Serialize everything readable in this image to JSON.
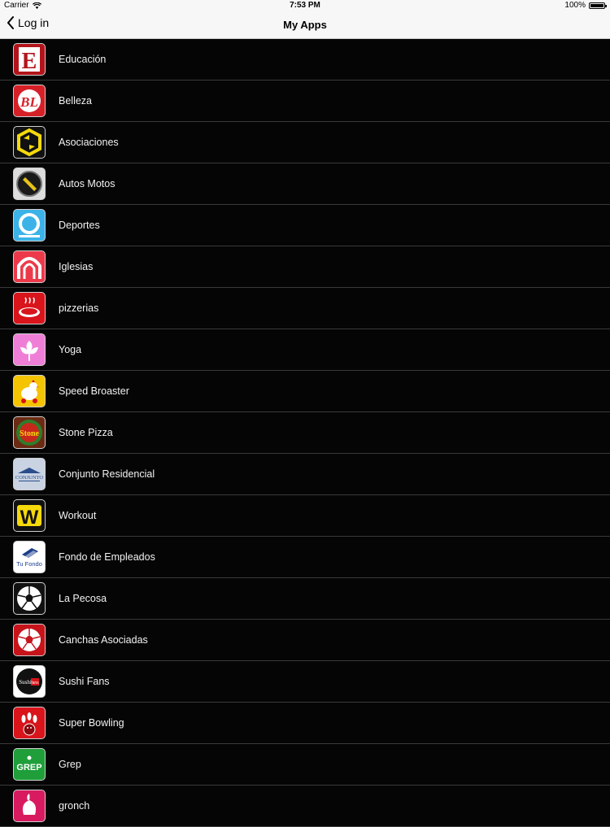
{
  "status": {
    "carrier": "Carrier",
    "time": "7:53 PM",
    "battery": "100%",
    "battery_level": 1.0
  },
  "nav": {
    "back_label": "Log in",
    "title": "My Apps"
  },
  "apps": [
    {
      "name": "Educación",
      "icon": "letter-e-icon"
    },
    {
      "name": "Belleza",
      "icon": "bl-monogram-icon"
    },
    {
      "name": "Asociaciones",
      "icon": "hexagon-arrows-icon"
    },
    {
      "name": "Autos Motos",
      "icon": "round-badge-icon"
    },
    {
      "name": "Deportes",
      "icon": "ring-icon"
    },
    {
      "name": "Iglesias",
      "icon": "arch-icon"
    },
    {
      "name": "pizzerias",
      "icon": "pizza-icon"
    },
    {
      "name": "Yoga",
      "icon": "lotus-icon"
    },
    {
      "name": "Speed Broaster",
      "icon": "chicken-mascot-icon"
    },
    {
      "name": "Stone Pizza",
      "icon": "stone-pizza-logo-icon"
    },
    {
      "name": "Conjunto Residencial",
      "icon": "building-logo-icon"
    },
    {
      "name": "Workout",
      "icon": "letter-w-icon"
    },
    {
      "name": "Fondo de Empleados",
      "icon": "tu-fondo-logo-icon"
    },
    {
      "name": "La Pecosa",
      "icon": "soccer-ball-icon"
    },
    {
      "name": "Canchas Asociadas",
      "icon": "red-soccer-ball-icon"
    },
    {
      "name": "Sushi Fans",
      "icon": "sushi-fans-logo-icon"
    },
    {
      "name": "Super Bowling",
      "icon": "bowling-icon"
    },
    {
      "name": "Grep",
      "icon": "grep-logo-icon"
    },
    {
      "name": "gronch",
      "icon": "gronch-logo-icon"
    }
  ],
  "icon_texts": {
    "educacion": "E",
    "belleza": "BL",
    "workout": "W",
    "tufondo": "Tu Fondo",
    "conjunto": "CONJUNTO",
    "sushi": "Sushi",
    "sushi_accent": "fans",
    "stone": "Stone",
    "grep": "GREP"
  },
  "colors": {
    "background": "#000000",
    "bar": "#f7f7f7",
    "separator": "#3a3a3a",
    "text": "#f2f2f2"
  }
}
